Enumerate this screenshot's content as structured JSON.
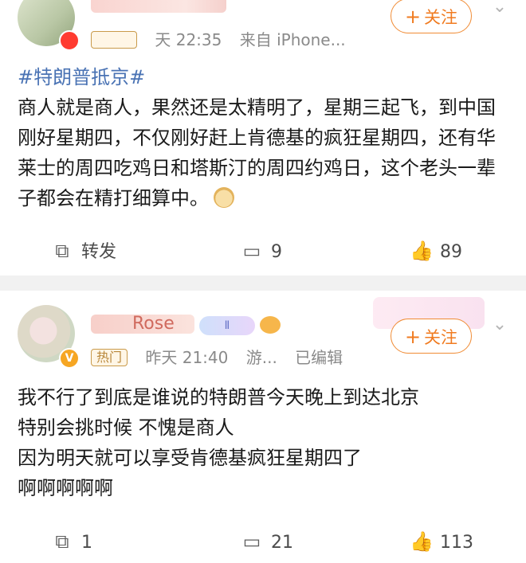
{
  "post1": {
    "hot_label": "",
    "time": "天 22:35",
    "source": "来自 iPhone...",
    "follow_label": "关注",
    "hashtag": "#特朗普抵京#",
    "text": "商人就是商人，果然还是太精明了，星期三起飞，到中国刚好星期四，不仅刚好赶上肯德基的疯狂星期四，还有华莱士的周四吃鸡日和塔斯汀的周四约鸡日，这个老头一辈子都会在精打细算中。",
    "actions": {
      "share_label": "转发",
      "comment_count": "9",
      "like_count": "89"
    }
  },
  "post2": {
    "username_fragment": "Rose",
    "flair_text": "Ⅱ",
    "hot_label": "热门",
    "time": "昨天 21:40",
    "source": "游...",
    "edited": "已编辑",
    "follow_label": "关注",
    "lines": [
      "我不行了到底是谁说的特朗普今天晚上到达北京",
      "特别会挑时候 不愧是商人",
      "因为明天就可以享受肯德基疯狂星期四了",
      "啊啊啊啊啊"
    ],
    "actions": {
      "share_count": "1",
      "comment_count": "21",
      "like_count": "113"
    }
  },
  "colors": {
    "accent": "#f07b20",
    "hashtag": "#4a73b4",
    "meta": "#8a8a8a",
    "separator": "#f1f1f1"
  },
  "icons": [
    "share-icon",
    "comment-icon",
    "like-icon",
    "chevron-down-icon",
    "plus-icon"
  ]
}
